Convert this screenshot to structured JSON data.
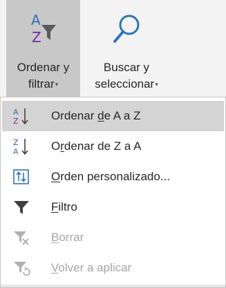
{
  "ribbon": {
    "sort_filter": {
      "line1": "Ordenar y",
      "line2": "filtrar",
      "icon": "sort-az-funnel-icon"
    },
    "find_select": {
      "line1": "Buscar y",
      "line2": "seleccionar",
      "icon": "magnifier-icon"
    },
    "dropdown_caret": "▾"
  },
  "menu": {
    "items": [
      {
        "pre": "Ordenar ",
        "u": "d",
        "post": "e A a Z",
        "icon": "sort-a-to-z-icon",
        "highlighted": true,
        "disabled": false
      },
      {
        "pre": "O",
        "u": "r",
        "post": "denar de Z a A",
        "icon": "sort-z-to-a-icon",
        "highlighted": false,
        "disabled": false
      },
      {
        "pre": "",
        "u": "O",
        "post": "rden personalizado...",
        "icon": "custom-sort-icon",
        "highlighted": false,
        "disabled": false
      },
      {
        "pre": "",
        "u": "F",
        "post": "iltro",
        "icon": "filter-funnel-icon",
        "highlighted": false,
        "disabled": false
      },
      {
        "pre": "",
        "u": "B",
        "post": "orrar",
        "icon": "clear-filter-icon",
        "highlighted": false,
        "disabled": true
      },
      {
        "pre": "",
        "u": "V",
        "post": "olver a aplicar",
        "icon": "reapply-filter-icon",
        "highlighted": false,
        "disabled": true
      }
    ]
  },
  "colors": {
    "highlight": "#d4d4d4",
    "ribbon_pressed": "#c8c8c8",
    "icon_blue": "#2e75b6",
    "icon_purple": "#7030a0",
    "icon_gray": "#404040",
    "disabled_text": "#a6a6a6"
  }
}
